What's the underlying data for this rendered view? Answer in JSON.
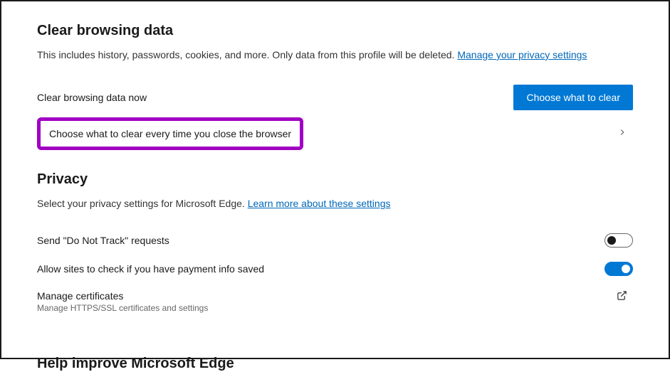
{
  "clearData": {
    "heading": "Clear browsing data",
    "desc": "This includes history, passwords, cookies, and more. Only data from this profile will be deleted. ",
    "manageLink": "Manage your privacy settings",
    "nowLabel": "Clear browsing data now",
    "chooseBtn": "Choose what to clear",
    "onCloseLabel": "Choose what to clear every time you close the browser"
  },
  "privacy": {
    "heading": "Privacy",
    "desc": "Select your privacy settings for Microsoft Edge. ",
    "learnLink": "Learn more about these settings",
    "dntLabel": "Send \"Do Not Track\" requests",
    "paymentLabel": "Allow sites to check if you have payment info saved",
    "certLabel": "Manage certificates",
    "certSub": "Manage HTTPS/SSL certificates and settings"
  },
  "help": {
    "heading": "Help improve Microsoft Edge"
  }
}
